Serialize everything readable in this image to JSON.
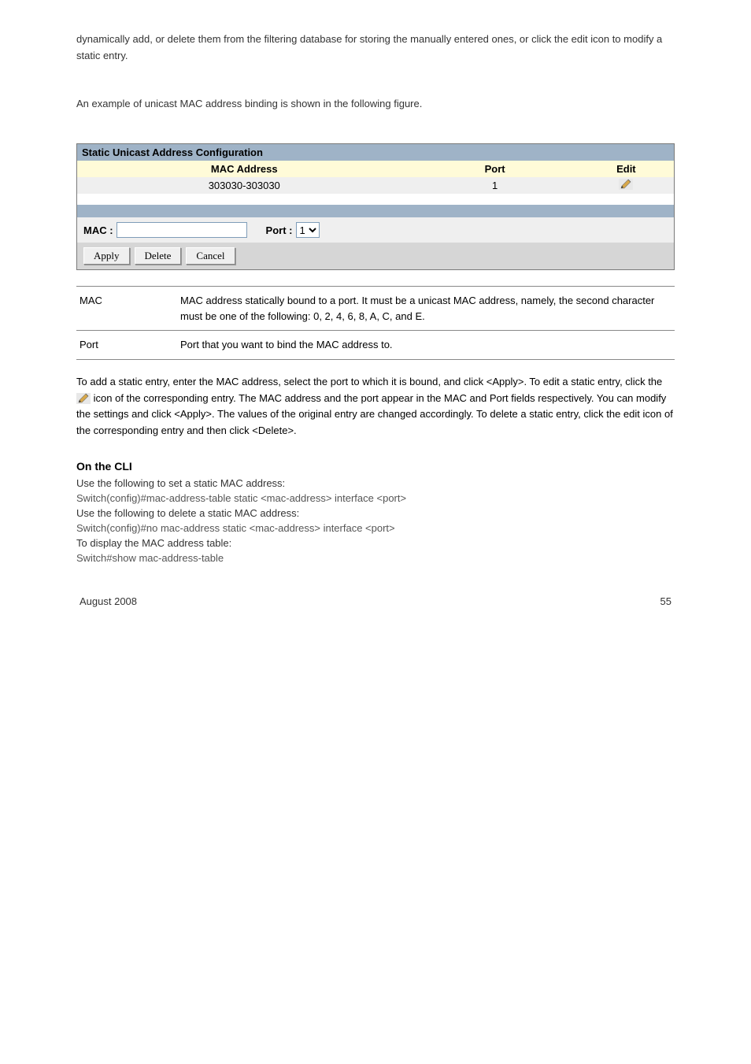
{
  "pageIntro": "dynamically add, or delete them from the filtering database for storing the manually entered ones, or click the edit icon to modify a static entry.",
  "pageIntro2": "An example of unicast MAC address binding is shown in the following figure.",
  "config": {
    "title": "Static Unicast Address Configuration",
    "headers": {
      "mac": "MAC Address",
      "port": "Port",
      "edit": "Edit"
    },
    "rows": [
      {
        "mac": "303030-303030",
        "port": "1"
      }
    ],
    "form": {
      "macLabel": "MAC :",
      "portLabel": "Port :",
      "macValue": "",
      "portOptions": [
        "1"
      ],
      "selectedPort": "1"
    },
    "buttons": {
      "apply": "Apply",
      "delete": "Delete",
      "cancel": "Cancel"
    }
  },
  "defs": {
    "mac": {
      "label": "MAC",
      "text": "MAC address statically bound to a port. It must be a unicast MAC address, namely, the second character must be one of the following: 0, 2, 4, 6, 8, A, C, and E."
    },
    "port": {
      "label": "Port",
      "text": "Port that you want to bind the MAC address to."
    }
  },
  "editPara": {
    "before": "To add a static entry, enter the MAC address, select the port to which it is bound, and click <Apply>. To edit a static entry, click the ",
    "after": " icon of the corresponding entry. The MAC address and the port appear in the MAC and Port fields respectively. You can modify the settings and click <Apply>. The values of the original entry are changed accordingly. To delete a static entry, click the edit icon of the corresponding entry and then click <Delete>."
  },
  "cli": {
    "heading": "On the CLI",
    "lines": [
      "Use the following to set a static MAC address:",
      "Switch(config)#mac-address-table static <mac-address> interface <port>",
      "Use the following to delete a static MAC address:",
      "Switch(config)#no mac-address static <mac-address> interface <port>",
      "To display the MAC address table:",
      "Switch#show mac-address-table"
    ]
  },
  "footer": {
    "left": "August 2008",
    "right": "55"
  },
  "icons": {
    "pencil": "pencil-icon"
  }
}
